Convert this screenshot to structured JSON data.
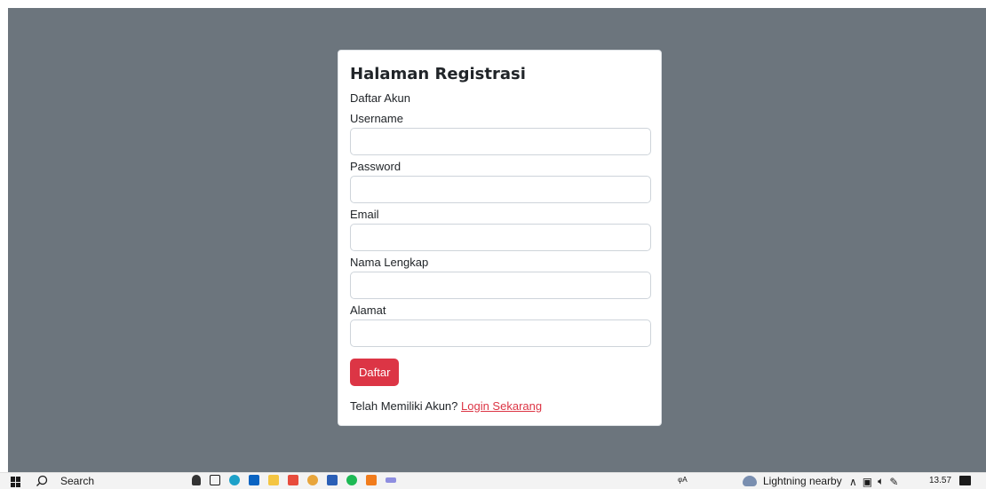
{
  "form": {
    "title": "Halaman Registrasi",
    "subtitle": "Daftar Akun",
    "fields": [
      {
        "label": "Username",
        "value": ""
      },
      {
        "label": "Password",
        "value": ""
      },
      {
        "label": "Email",
        "value": ""
      },
      {
        "label": "Nama Lengkap",
        "value": ""
      },
      {
        "label": "Alamat",
        "value": ""
      }
    ],
    "submit_label": "Daftar",
    "footer_text": "Telah Memiliki Akun?",
    "login_link": "Login Sekarang"
  },
  "taskbar": {
    "search_label": "Search",
    "weather": "Lightning nearby",
    "time": "13.57"
  },
  "colors": {
    "background": "#6c757d",
    "accent": "#dc3545"
  }
}
